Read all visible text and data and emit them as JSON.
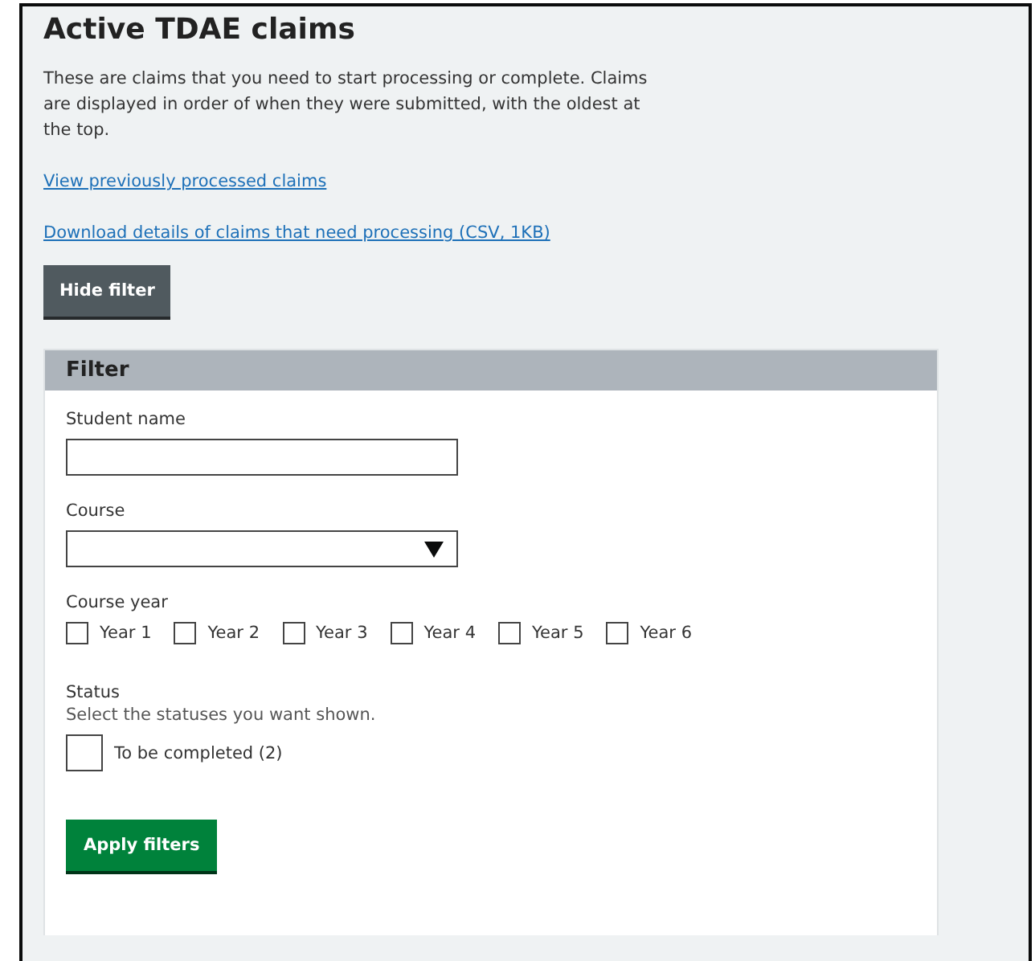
{
  "title": "Active TDAE claims",
  "intro": "These are claims that you need to start processing or complete. Claims are displayed in order of when they were submitted, with the oldest at the top.",
  "links": [
    "View previously processed claims",
    "Download details of claims that need processing (CSV, 1KB)"
  ],
  "toggle_button": "Hide filter",
  "filter": {
    "heading": "Filter",
    "student_name": {
      "label": "Student name"
    },
    "course": {
      "label": "Course"
    },
    "course_year": {
      "label": "Course year",
      "options": [
        {
          "label": "Year 1",
          "checked": false
        },
        {
          "label": "Year 2",
          "checked": false
        },
        {
          "label": "Year 3",
          "checked": false
        },
        {
          "label": "Year 4",
          "checked": false
        },
        {
          "label": "Year 5",
          "checked": false
        },
        {
          "label": "Year 6",
          "checked": false
        }
      ]
    },
    "status": {
      "label": "Status",
      "hint": "Select the statuses you want shown.",
      "options": [
        {
          "label": "To be completed (2)",
          "checked": false
        }
      ]
    },
    "apply_button": "Apply filters"
  }
}
